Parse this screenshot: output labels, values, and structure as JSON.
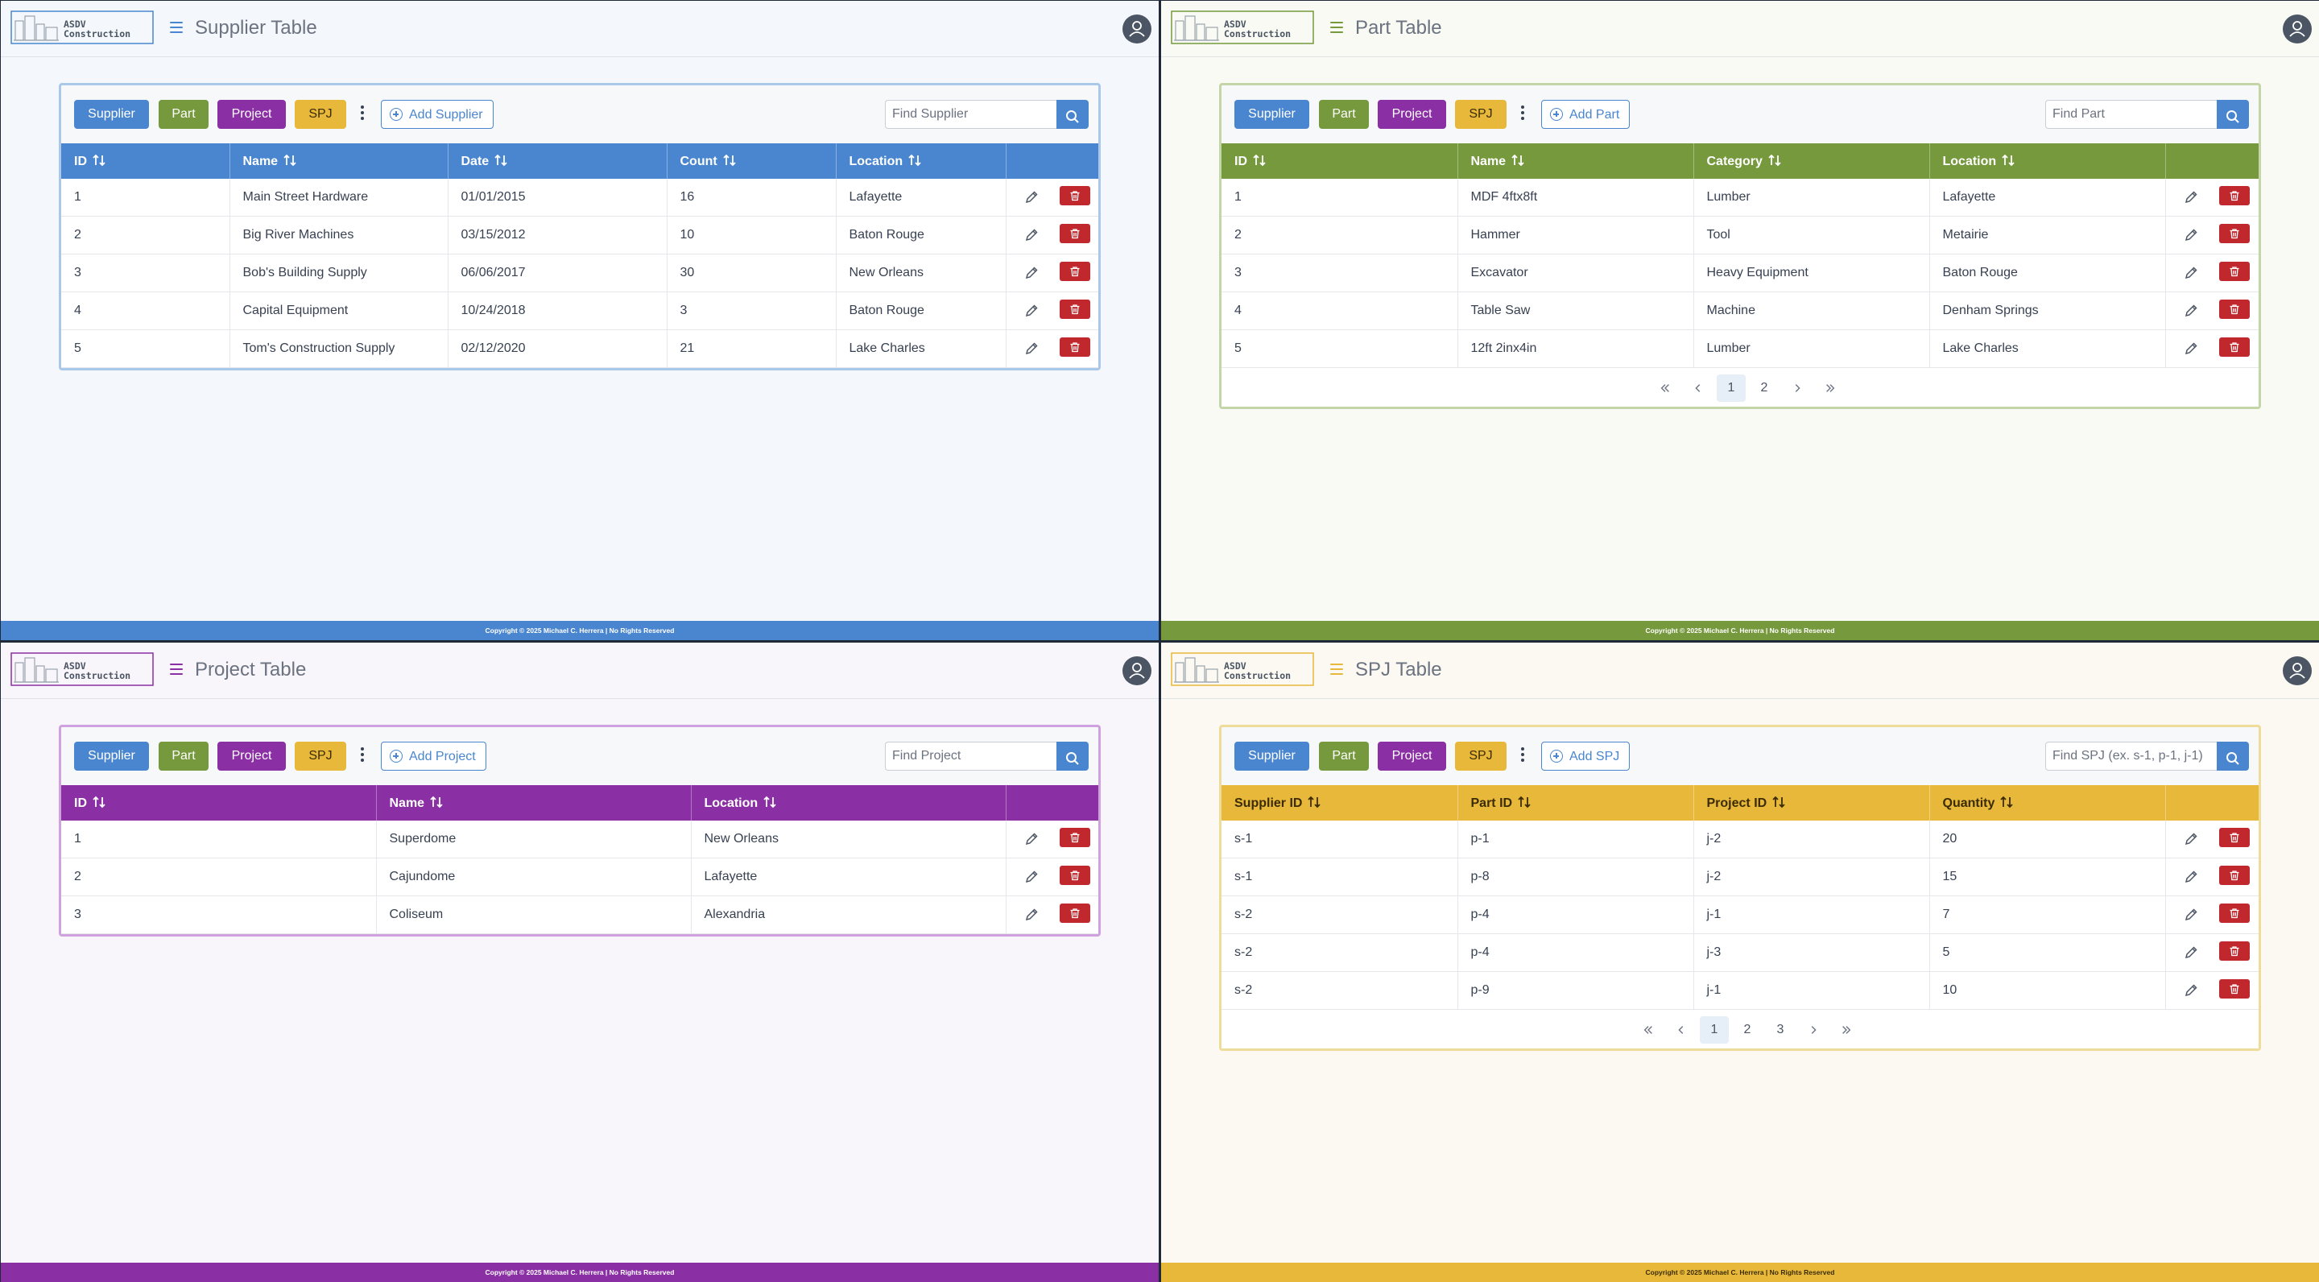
{
  "app": {
    "logo": {
      "line1": "ASDV",
      "line2": "Construction"
    },
    "nav": {
      "supplier": "Supplier",
      "part": "Part",
      "project": "Project",
      "spj": "SPJ"
    },
    "footer": "Copyright © 2025 Michael C. Herrera  |  No Rights Reserved"
  },
  "colors": {
    "supplier": "#4a86cf",
    "part": "#75993c",
    "project": "#8a2fa4",
    "spj": "#e8b83b"
  },
  "icons": [
    "menu-icon",
    "user-icon",
    "kebab-icon",
    "plus-circle-icon",
    "search-icon",
    "sort-icon",
    "pencil-icon",
    "trash-icon",
    "chevron-double-left-icon",
    "chevron-left-icon",
    "chevron-right-icon",
    "chevron-double-right-icon"
  ],
  "supplier": {
    "title": "Supplier Table",
    "add_label": "Add Supplier",
    "search_placeholder": "Find Supplier",
    "columns": [
      "ID",
      "Name",
      "Date",
      "Count",
      "Location"
    ],
    "rows": [
      [
        "1",
        "Main Street Hardware",
        "01/01/2015",
        "16",
        "Lafayette"
      ],
      [
        "2",
        "Big River Machines",
        "03/15/2012",
        "10",
        "Baton Rouge"
      ],
      [
        "3",
        "Bob's Building Supply",
        "06/06/2017",
        "30",
        "New Orleans"
      ],
      [
        "4",
        "Capital Equipment",
        "10/24/2018",
        "3",
        "Baton Rouge"
      ],
      [
        "5",
        "Tom's Construction Supply",
        "02/12/2020",
        "21",
        "Lake Charles"
      ]
    ]
  },
  "part": {
    "title": "Part Table",
    "add_label": "Add Part",
    "search_placeholder": "Find Part",
    "columns": [
      "ID",
      "Name",
      "Category",
      "Location"
    ],
    "rows": [
      [
        "1",
        "MDF 4ftx8ft",
        "Lumber",
        "Lafayette"
      ],
      [
        "2",
        "Hammer",
        "Tool",
        "Metairie"
      ],
      [
        "3",
        "Excavator",
        "Heavy Equipment",
        "Baton Rouge"
      ],
      [
        "4",
        "Table Saw",
        "Machine",
        "Denham Springs"
      ],
      [
        "5",
        "12ft 2inx4in",
        "Lumber",
        "Lake Charles"
      ]
    ],
    "pages": [
      "1",
      "2"
    ],
    "current_page": "1"
  },
  "project": {
    "title": "Project Table",
    "add_label": "Add Project",
    "search_placeholder": "Find Project",
    "columns": [
      "ID",
      "Name",
      "Location"
    ],
    "rows": [
      [
        "1",
        "Superdome",
        "New Orleans"
      ],
      [
        "2",
        "Cajundome",
        "Lafayette"
      ],
      [
        "3",
        "Coliseum",
        "Alexandria"
      ]
    ]
  },
  "spj": {
    "title": "SPJ Table",
    "add_label": "Add SPJ",
    "search_placeholder": "Find SPJ (ex. s-1, p-1, j-1)",
    "columns": [
      "Supplier ID",
      "Part ID",
      "Project ID",
      "Quantity"
    ],
    "rows": [
      [
        "s-1",
        "p-1",
        "j-2",
        "20"
      ],
      [
        "s-1",
        "p-8",
        "j-2",
        "15"
      ],
      [
        "s-2",
        "p-4",
        "j-1",
        "7"
      ],
      [
        "s-2",
        "p-4",
        "j-3",
        "5"
      ],
      [
        "s-2",
        "p-9",
        "j-1",
        "10"
      ]
    ],
    "pages": [
      "1",
      "2",
      "3"
    ],
    "current_page": "1"
  }
}
